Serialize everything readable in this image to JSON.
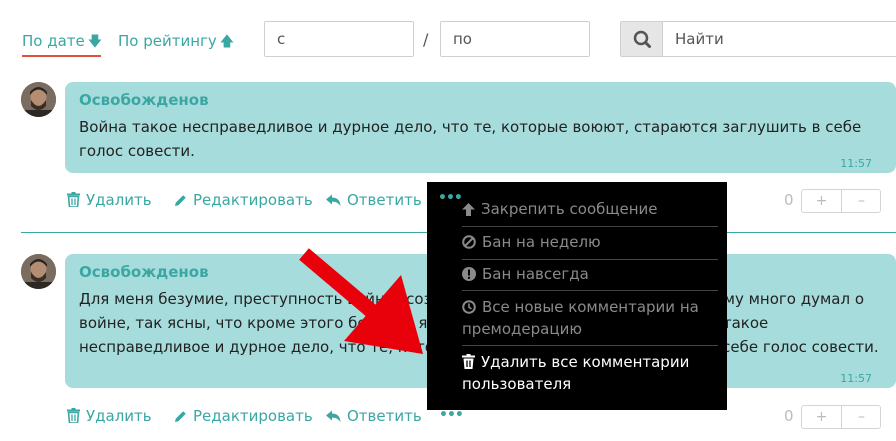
{
  "sort": {
    "by_date": "По дате",
    "by_rating": "По рейтингу"
  },
  "date_filter": {
    "from_placeholder": "с",
    "separator": "/",
    "to_placeholder": "по"
  },
  "search": {
    "placeholder": "Найти"
  },
  "comments": [
    {
      "author": "Освобожденов",
      "text": "Война такое несправедливое и дурное дело, что те, которые воюют, стараются заглушить в себе голос совести.",
      "time": "11:57",
      "rating": "0"
    },
    {
      "author": "Освобожденов",
      "text": "Для меня безумие, преступность войны, сознание, что я так много думал и потому много думал о войне, так ясны, что кроме этого безумия я ничего не могу в ней видеть. Война такое несправедливое и дурное дело, что те, которые воюют, стараются заглушить в себе голос совести.",
      "time": "11:57",
      "rating": "0"
    }
  ],
  "actions": {
    "delete": "Удалить",
    "edit": "Редактировать",
    "reply": "Ответить",
    "more": "•••",
    "plus": "+",
    "minus": "–"
  },
  "menu": {
    "pin": "Закрепить сообщение",
    "ban_week": "Бан на неделю",
    "ban_forever": "Бан навсегда",
    "premoderate": "Все новые комментарии на премодерацию",
    "delete_all": "Удалить все комментарии пользователя"
  },
  "colors": {
    "accent": "#3aa7a3",
    "bubble": "#a7dcdc",
    "underline": "#e0523e",
    "menu_bg": "#000000",
    "arrow": "#e8000b"
  }
}
